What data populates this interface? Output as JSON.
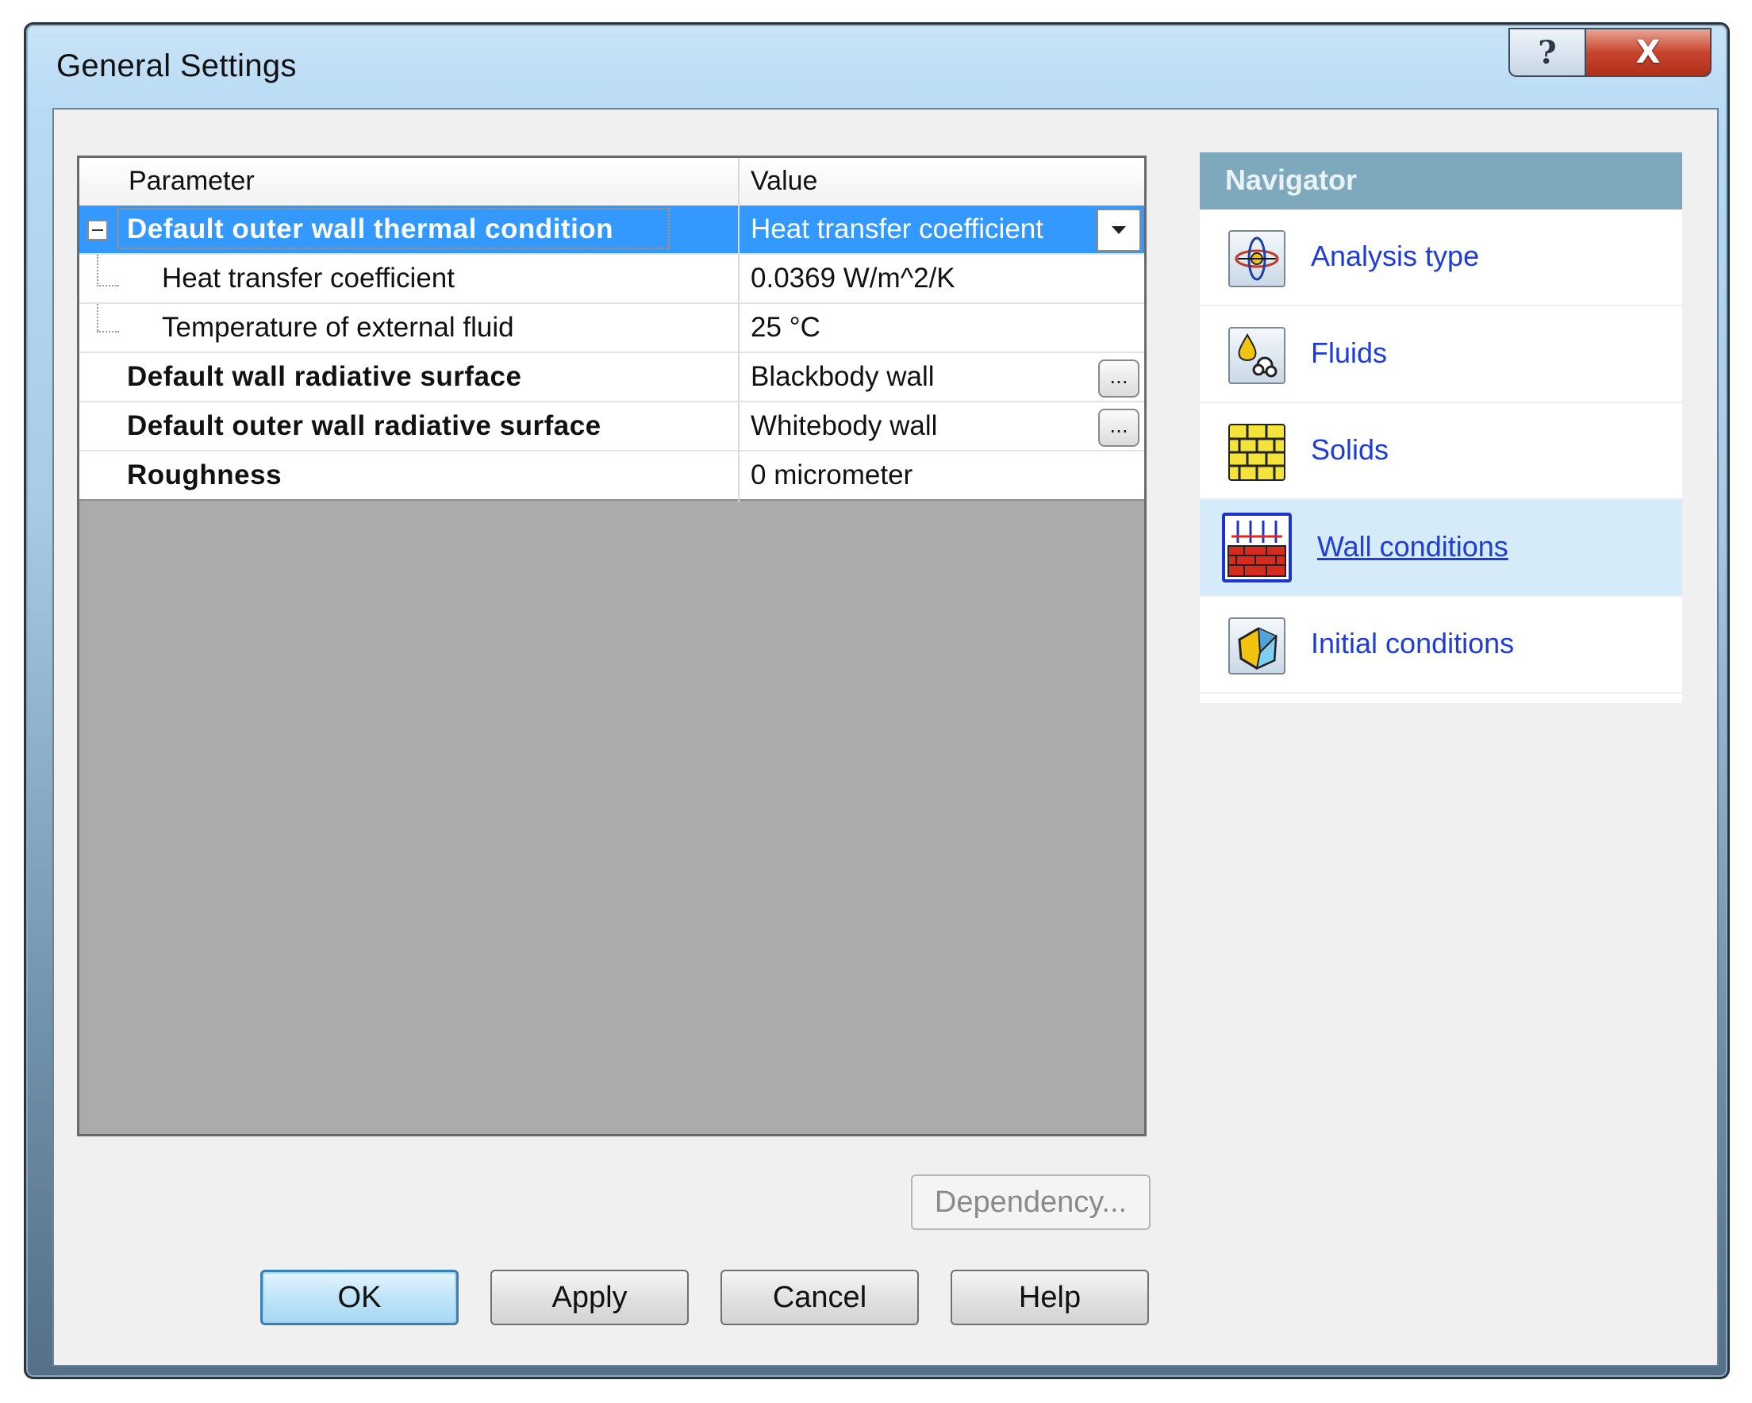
{
  "window": {
    "title": "General Settings",
    "help_glyph": "?",
    "close_glyph": "X"
  },
  "grid": {
    "columns": [
      "Parameter",
      "Value"
    ],
    "rows": [
      {
        "parameter": "Default outer wall thermal condition",
        "value": "Heat transfer coefficient",
        "bold": true,
        "selected": true,
        "control": "dropdown"
      },
      {
        "parameter": "Heat transfer coefficient",
        "value": "0.0369 W/m^2/K",
        "bold": false,
        "child": true
      },
      {
        "parameter": "Temperature of external fluid",
        "value": "25 °C",
        "bold": false,
        "child": true
      },
      {
        "parameter": "Default wall radiative surface",
        "value": "Blackbody wall",
        "bold": true,
        "control": "ellipsis"
      },
      {
        "parameter": "Default outer wall radiative surface",
        "value": "Whitebody wall",
        "bold": true,
        "control": "ellipsis"
      },
      {
        "parameter": "Roughness",
        "value": "0 micrometer",
        "bold": true
      }
    ],
    "ellipsis_label": "..."
  },
  "navigator": {
    "title": "Navigator",
    "items": [
      {
        "label": "Analysis type",
        "icon": "analysis-type-icon"
      },
      {
        "label": "Fluids",
        "icon": "fluids-icon"
      },
      {
        "label": "Solids",
        "icon": "solids-icon"
      },
      {
        "label": "Wall conditions",
        "icon": "wall-conditions-icon",
        "active": true
      },
      {
        "label": "Initial conditions",
        "icon": "initial-conditions-icon"
      }
    ]
  },
  "buttons": {
    "dependency": "Dependency...",
    "ok": "OK",
    "apply": "Apply",
    "cancel": "Cancel",
    "help": "Help"
  },
  "colors": {
    "selection": "#3399ff",
    "nav_header": "#7ea9bd",
    "nav_link": "#1e3cd6",
    "grid_empty": "#ababab"
  }
}
